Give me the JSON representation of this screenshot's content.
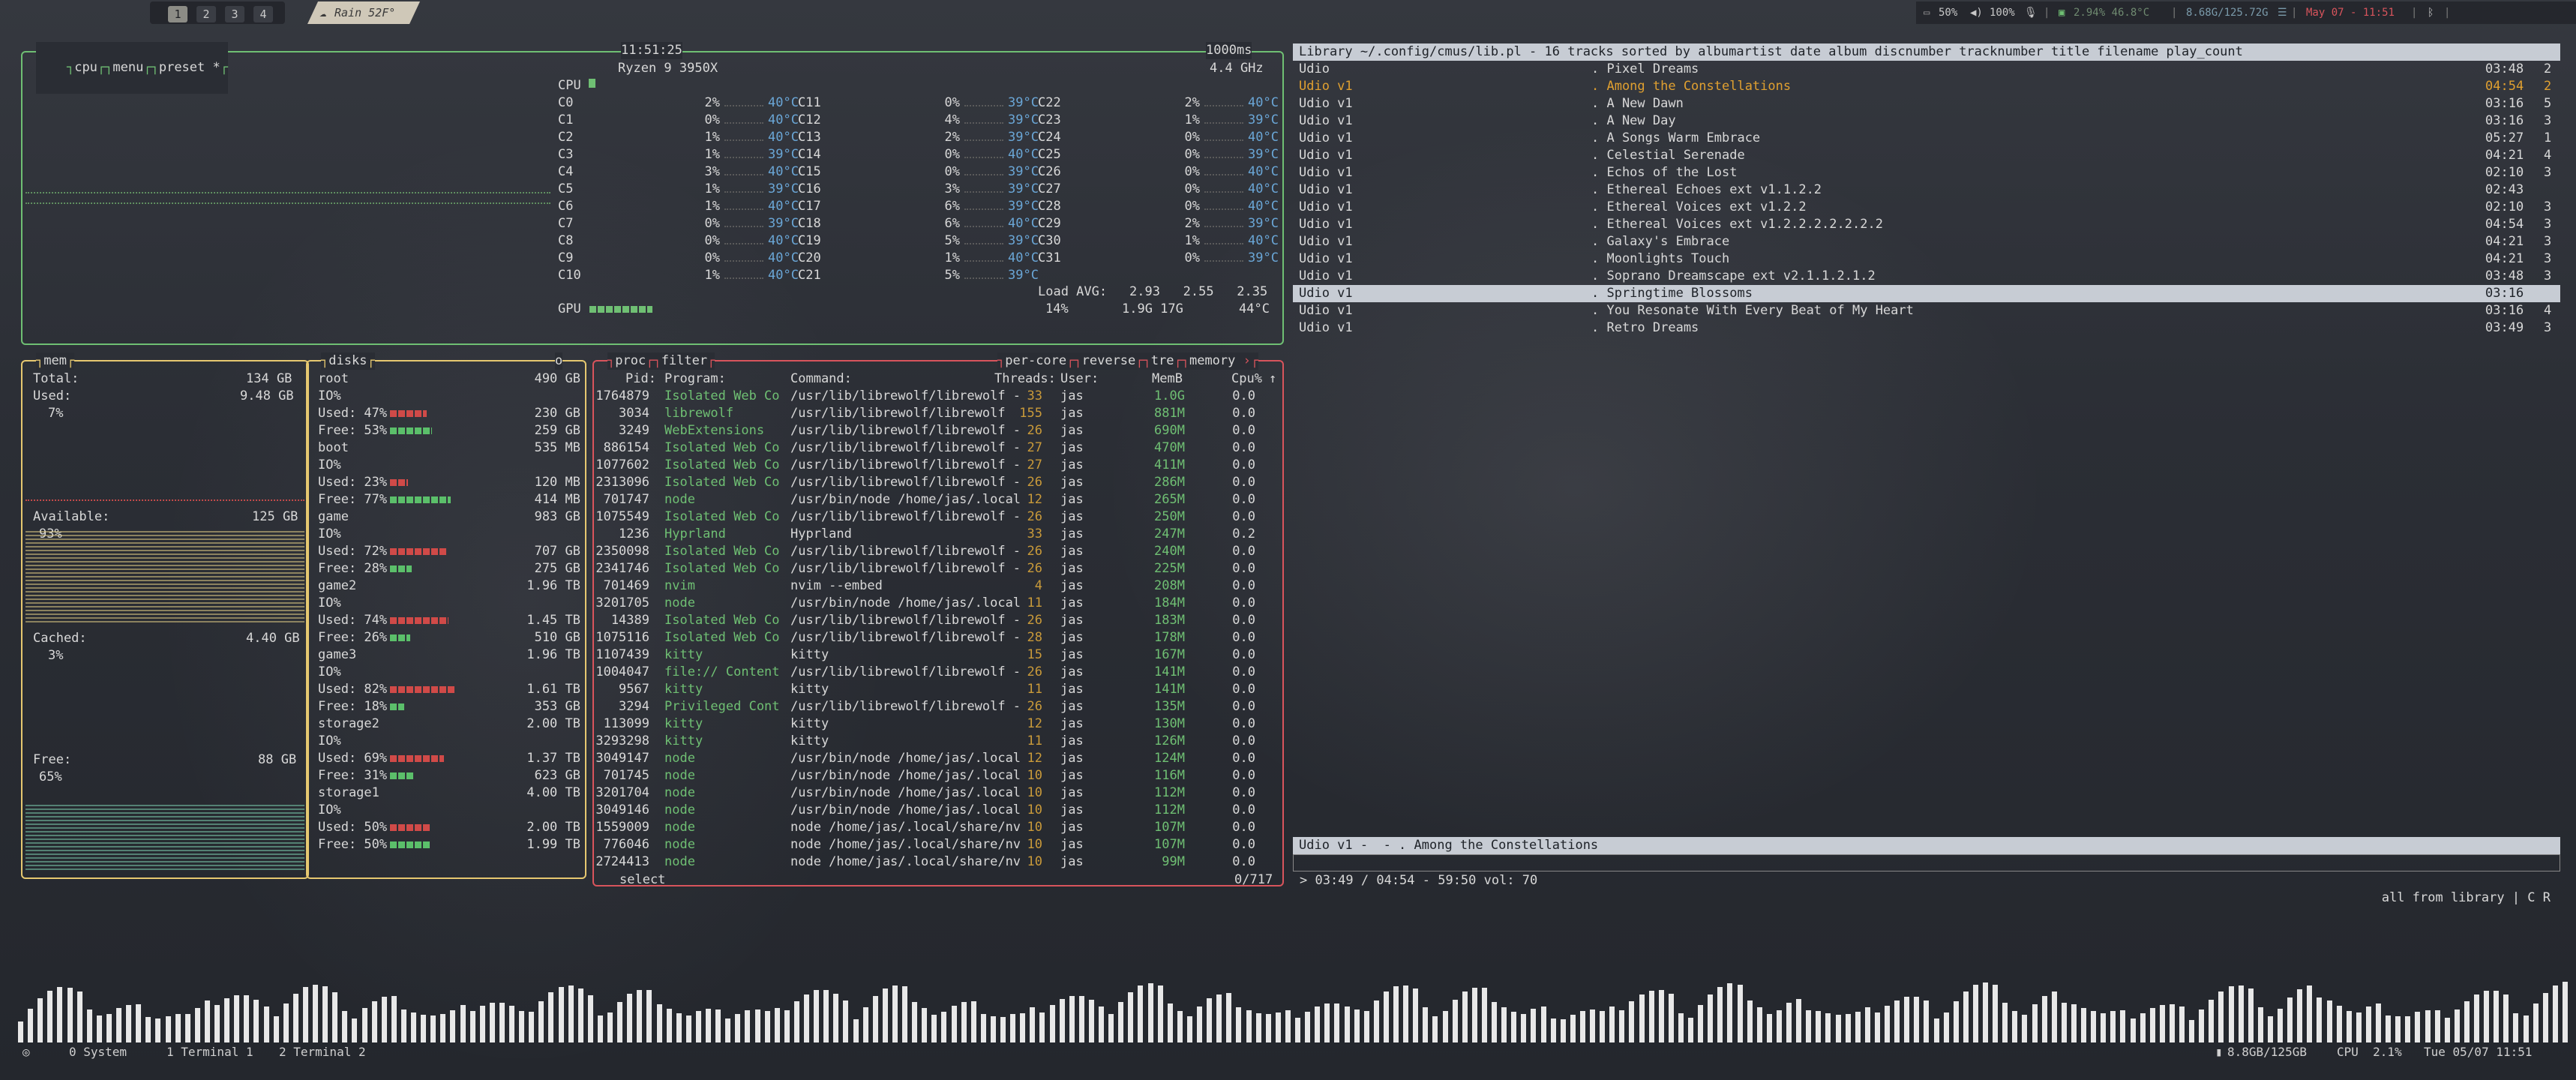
{
  "topbar": {
    "workspaces": [
      "1",
      "2",
      "3",
      "4"
    ],
    "active_workspace": "1",
    "weather": "Rain 52F°",
    "volume": "50%",
    "mic": "100%",
    "cpu_temp": "2.94% 46.8°C",
    "memory": "8.68G/125.72G",
    "datetime": "May 07 - 11:51"
  },
  "cpu": {
    "title_cpu": "cpu",
    "title_menu": "menu",
    "title_preset": "preset *",
    "clock": "11:51:25",
    "interval": "1000ms",
    "model": "Ryzen 9 3950X",
    "freq": "4.4 GHz",
    "cpu_label": "CPU",
    "cores": [
      [
        "C0",
        "2%",
        "40°C",
        "C11",
        "0%",
        "39°C",
        "C22",
        "2%",
        "40°C"
      ],
      [
        "C1",
        "0%",
        "40°C",
        "C12",
        "4%",
        "39°C",
        "C23",
        "1%",
        "39°C"
      ],
      [
        "C2",
        "1%",
        "40°C",
        "C13",
        "2%",
        "39°C",
        "C24",
        "0%",
        "40°C"
      ],
      [
        "C3",
        "1%",
        "39°C",
        "C14",
        "0%",
        "40°C",
        "C25",
        "0%",
        "39°C"
      ],
      [
        "C4",
        "3%",
        "40°C",
        "C15",
        "0%",
        "39°C",
        "C26",
        "0%",
        "40°C"
      ],
      [
        "C5",
        "1%",
        "39°C",
        "C16",
        "3%",
        "39°C",
        "C27",
        "0%",
        "40°C"
      ],
      [
        "C6",
        "1%",
        "40°C",
        "C17",
        "6%",
        "39°C",
        "C28",
        "0%",
        "40°C"
      ],
      [
        "C7",
        "0%",
        "39°C",
        "C18",
        "6%",
        "40°C",
        "C29",
        "2%",
        "39°C"
      ],
      [
        "C8",
        "0%",
        "40°C",
        "C19",
        "5%",
        "39°C",
        "C30",
        "1%",
        "40°C"
      ],
      [
        "C9",
        "0%",
        "40°C",
        "C20",
        "1%",
        "40°C",
        "C31",
        "0%",
        "39°C"
      ],
      [
        "C10",
        "1%",
        "40°C",
        "C21",
        "5%",
        "39°C",
        "",
        "",
        ""
      ]
    ],
    "load_label": "Load AVG:",
    "load": "2.93   2.55   2.35",
    "gpu_label": "GPU",
    "gpu_pct": "14%",
    "gpu_mem": "1.9G 17G",
    "gpu_temp": "44°C"
  },
  "mem": {
    "title": "mem",
    "total_label": "Total:",
    "total": "134 GB",
    "used_label": "Used:",
    "used": "9.48 GB",
    "used_pct": "7%",
    "avail_label": "Available:",
    "avail": "125 GB",
    "avail_pct": "93%",
    "cached_label": "Cached:",
    "cached": "4.40 GB",
    "cached_pct": "3%",
    "free_label": "Free:",
    "free": "88 GB",
    "free_pct": "65%"
  },
  "disks": {
    "title": "disks",
    "io_tag": "o",
    "items": [
      {
        "name": "root",
        "size": "490 GB",
        "used": "Used: 47%",
        "used_v": "230 GB",
        "free": "Free: 53%",
        "free_v": "259 GB"
      },
      {
        "name": "boot",
        "size": "535 MB",
        "used": "Used: 23%",
        "used_v": "120 MB",
        "free": "Free: 77%",
        "free_v": "414 MB"
      },
      {
        "name": "game",
        "size": "983 GB",
        "used": "Used: 72%",
        "used_v": "707 GB",
        "free": "Free: 28%",
        "free_v": "275 GB"
      },
      {
        "name": "game2",
        "size": "1.96 TB",
        "used": "Used: 74%",
        "used_v": "1.45 TB",
        "free": "Free: 26%",
        "free_v": "510 GB"
      },
      {
        "name": "game3",
        "size": "1.96 TB",
        "used": "Used: 82%",
        "used_v": "1.61 TB",
        "free": "Free: 18%",
        "free_v": "353 GB"
      },
      {
        "name": "storage2",
        "size": "2.00 TB",
        "used": "Used: 69%",
        "used_v": "1.37 TB",
        "free": "Free: 31%",
        "free_v": "623 GB"
      },
      {
        "name": "storage1",
        "size": "4.00 TB",
        "used": "Used: 50%",
        "used_v": "2.00 TB",
        "free": "Free: 50%",
        "free_v": "1.99 TB"
      }
    ],
    "io_label": "IO%"
  },
  "proc": {
    "title_proc": "proc",
    "title_filter": "filter",
    "title_per_core": "per-core",
    "title_reverse": "reverse",
    "title_tree": "tre",
    "title_sort": "memory",
    "headers": [
      "Pid:",
      "Program:",
      "Command:",
      "Threads:",
      "User:",
      "MemB",
      "Cpu%"
    ],
    "rows": [
      [
        "1764879",
        "Isolated Web Co",
        "/usr/lib/librewolf/librewolf -",
        "33",
        "jas",
        "1.0G",
        "0.0"
      ],
      [
        "3034",
        "librewolf",
        "/usr/lib/librewolf/librewolf",
        "155",
        "jas",
        "881M",
        "0.0"
      ],
      [
        "3249",
        "WebExtensions",
        "/usr/lib/librewolf/librewolf -",
        "26",
        "jas",
        "690M",
        "0.0"
      ],
      [
        "886154",
        "Isolated Web Co",
        "/usr/lib/librewolf/librewolf -",
        "27",
        "jas",
        "470M",
        "0.0"
      ],
      [
        "1077602",
        "Isolated Web Co",
        "/usr/lib/librewolf/librewolf -",
        "27",
        "jas",
        "411M",
        "0.0"
      ],
      [
        "2313096",
        "Isolated Web Co",
        "/usr/lib/librewolf/librewolf -",
        "26",
        "jas",
        "286M",
        "0.0"
      ],
      [
        "701747",
        "node",
        "/usr/bin/node /home/jas/.local",
        "12",
        "jas",
        "265M",
        "0.0"
      ],
      [
        "1075549",
        "Isolated Web Co",
        "/usr/lib/librewolf/librewolf -",
        "26",
        "jas",
        "250M",
        "0.0"
      ],
      [
        "1236",
        "Hyprland",
        "Hyprland",
        "33",
        "jas",
        "247M",
        "0.2"
      ],
      [
        "2350098",
        "Isolated Web Co",
        "/usr/lib/librewolf/librewolf -",
        "26",
        "jas",
        "240M",
        "0.0"
      ],
      [
        "2341746",
        "Isolated Web Co",
        "/usr/lib/librewolf/librewolf -",
        "26",
        "jas",
        "225M",
        "0.0"
      ],
      [
        "701469",
        "nvim",
        "nvim --embed",
        "4",
        "jas",
        "208M",
        "0.0"
      ],
      [
        "3201705",
        "node",
        "/usr/bin/node /home/jas/.local",
        "11",
        "jas",
        "184M",
        "0.0"
      ],
      [
        "14389",
        "Isolated Web Co",
        "/usr/lib/librewolf/librewolf -",
        "26",
        "jas",
        "183M",
        "0.0"
      ],
      [
        "1075116",
        "Isolated Web Co",
        "/usr/lib/librewolf/librewolf -",
        "28",
        "jas",
        "178M",
        "0.0"
      ],
      [
        "1107439",
        "kitty",
        "kitty",
        "15",
        "jas",
        "167M",
        "0.0"
      ],
      [
        "1004047",
        "file:// Content",
        "/usr/lib/librewolf/librewolf -",
        "26",
        "jas",
        "141M",
        "0.0"
      ],
      [
        "9567",
        "kitty",
        "kitty",
        "11",
        "jas",
        "141M",
        "0.0"
      ],
      [
        "3294",
        "Privileged Cont",
        "/usr/lib/librewolf/librewolf -",
        "26",
        "jas",
        "135M",
        "0.0"
      ],
      [
        "113099",
        "kitty",
        "kitty",
        "12",
        "jas",
        "130M",
        "0.0"
      ],
      [
        "3293298",
        "kitty",
        "kitty",
        "11",
        "jas",
        "126M",
        "0.0"
      ],
      [
        "3049147",
        "node",
        "/usr/bin/node /home/jas/.local",
        "12",
        "jas",
        "124M",
        "0.0"
      ],
      [
        "701745",
        "node",
        "/usr/bin/node /home/jas/.local",
        "10",
        "jas",
        "116M",
        "0.0"
      ],
      [
        "3201704",
        "node",
        "/usr/bin/node /home/jas/.local",
        "10",
        "jas",
        "112M",
        "0.0"
      ],
      [
        "3049146",
        "node",
        "/usr/bin/node /home/jas/.local",
        "10",
        "jas",
        "112M",
        "0.0"
      ],
      [
        "1559009",
        "node",
        "node /home/jas/.local/share/nv",
        "10",
        "jas",
        "107M",
        "0.0"
      ],
      [
        "776046",
        "node",
        "node /home/jas/.local/share/nv",
        "10",
        "jas",
        "107M",
        "0.0"
      ],
      [
        "2724413",
        "node",
        "node /home/jas/.local/share/nv",
        "10",
        "jas",
        "99M",
        "0.0"
      ]
    ],
    "select_label": "select",
    "count": "0/717"
  },
  "cmus": {
    "header": "Library ~/.config/cmus/lib.pl - 16 tracks sorted by albumartist date album discnumber tracknumber title filename play_count",
    "tracks": [
      [
        "Udio",
        ". Pixel Dreams",
        "03:48",
        "2"
      ],
      [
        "Udio v1",
        ". Among the Constellations",
        "04:54",
        "2"
      ],
      [
        "Udio v1",
        ". A New Dawn",
        "03:16",
        "5"
      ],
      [
        "Udio v1",
        ". A New Day",
        "03:16",
        "3"
      ],
      [
        "Udio v1",
        ". A Songs Warm Embrace",
        "05:27",
        "1"
      ],
      [
        "Udio v1",
        ". Celestial Serenade",
        "04:21",
        "4"
      ],
      [
        "Udio v1",
        ". Echos of the Lost",
        "02:10",
        "3"
      ],
      [
        "Udio v1",
        ". Ethereal Echoes ext v1.1.2.2",
        "02:43",
        ""
      ],
      [
        "Udio v1",
        ". Ethereal Voices ext v1.2.2",
        "02:10",
        "3"
      ],
      [
        "Udio v1",
        ". Ethereal Voices ext v1.2.2.2.2.2.2.2",
        "04:54",
        "3"
      ],
      [
        "Udio v1",
        ". Galaxy's Embrace",
        "04:21",
        "3"
      ],
      [
        "Udio v1",
        ". Moonlights Touch",
        "04:21",
        "3"
      ],
      [
        "Udio v1",
        ". Soprano Dreamscape ext v2.1.1.2.1.2",
        "03:48",
        "3"
      ],
      [
        "Udio v1",
        ". Springtime Blossoms",
        "03:16",
        ""
      ],
      [
        "Udio v1",
        ". You Resonate With Every Beat of My Heart",
        "03:16",
        "4"
      ],
      [
        "Udio v1",
        ". Retro Dreams",
        "03:49",
        "3"
      ]
    ],
    "playing_index": 1,
    "selected_index": 13,
    "now_playing": "Udio v1 -  - . Among the Constellations",
    "status": "> 03:49 / 04:54 - 59:50 vol: 70",
    "status_right": "all from library | C R"
  },
  "waybar": {
    "workspaces": "0 System",
    "term1": "1 Terminal 1",
    "term2": "2 Terminal 2",
    "mem": "8.8GB/125GB",
    "cpu": "CPU  2.1%",
    "clock": "Tue 05/07 11:51"
  },
  "colors": {
    "cpu_border": "#6fbf73",
    "mem_border": "#e6c870",
    "proc_border": "#d8545c",
    "accent_orange": "#e0a030",
    "bar_red": "#d04a48",
    "bar_green": "#5bbf6a"
  }
}
